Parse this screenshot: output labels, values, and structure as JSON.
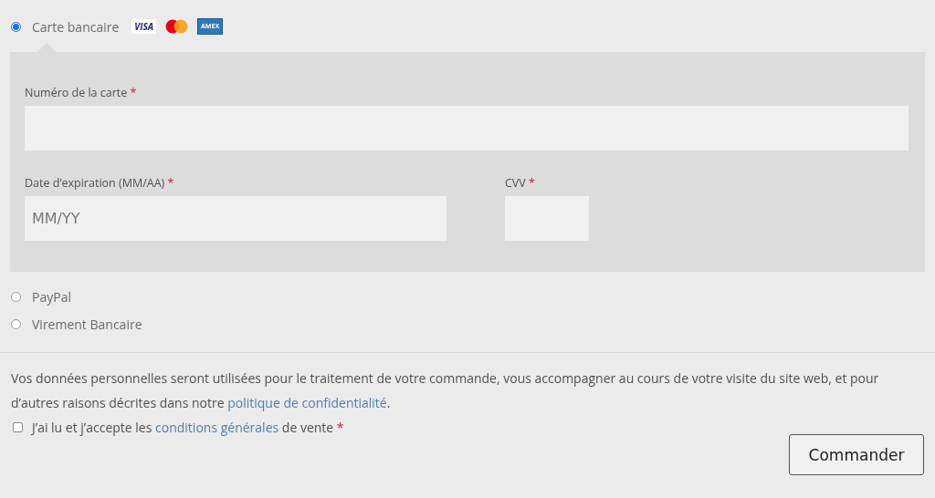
{
  "payment_methods": [
    {
      "label": "Carte bancaire",
      "selected": true,
      "logos": [
        {
          "kind": "visa",
          "text": "VISA"
        },
        {
          "kind": "mastercard"
        },
        {
          "kind": "amex",
          "text": "AMEX"
        }
      ],
      "fields": [
        {
          "label": "Numéro de la carte",
          "required_mark": "*"
        },
        {
          "label": "Date d’expiration (MM/AA)",
          "required_mark": "*",
          "placeholder": "MM/YY"
        },
        {
          "label": "CVV",
          "required_mark": "*"
        }
      ]
    },
    {
      "label": "PayPal",
      "selected": false
    },
    {
      "label": "Virement Bancaire",
      "selected": false
    }
  ],
  "privacy_text": {
    "before": "Vos données personnelles seront utilisées pour le traitement de votre commande, vous accompagner au cours de votre visite du site web, et pour d’autres raisons décrites dans notre ",
    "link": "politique de confidentialité",
    "after": "."
  },
  "terms": {
    "checked": false,
    "before": "J’ai lu et j’accepte les ",
    "link": "conditions générales",
    "after": " de vente",
    "required_mark": "*"
  },
  "submit_button": "Commander"
}
